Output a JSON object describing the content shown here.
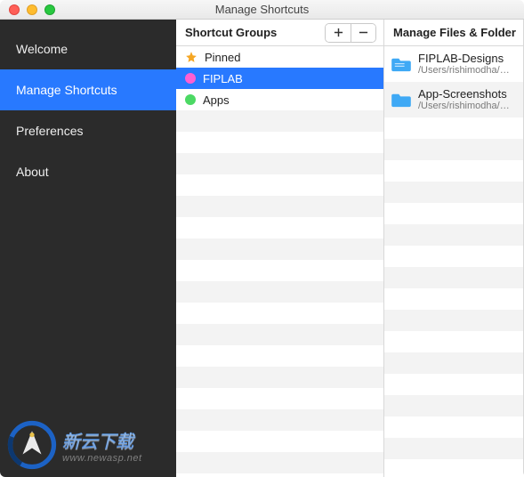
{
  "window": {
    "title": "Manage Shortcuts"
  },
  "sidebar": {
    "items": [
      {
        "label": "Welcome",
        "active": false
      },
      {
        "label": "Manage Shortcuts",
        "active": true
      },
      {
        "label": "Preferences",
        "active": false
      },
      {
        "label": "About",
        "active": false
      }
    ]
  },
  "groups": {
    "title": "Shortcut Groups",
    "items": [
      {
        "label": "Pinned",
        "icon": "star",
        "color": "#f5a623",
        "selected": false
      },
      {
        "label": "FIPLAB",
        "icon": "dot",
        "color": "#ff5fd2",
        "selected": true
      },
      {
        "label": "Apps",
        "icon": "dot",
        "color": "#4cd964",
        "selected": false
      }
    ]
  },
  "files": {
    "title": "Manage Files & Folders",
    "items": [
      {
        "name": "FIPLAB-Designs",
        "path": "/Users/rishimodha/Dropbox",
        "color": "#3fa9f5"
      },
      {
        "name": "App-Screenshots",
        "path": "/Users/rishimodha/Dropbox",
        "color": "#3fa9f5"
      }
    ]
  },
  "watermark": {
    "cn": "新云下载",
    "url": "www.newasp.net"
  }
}
